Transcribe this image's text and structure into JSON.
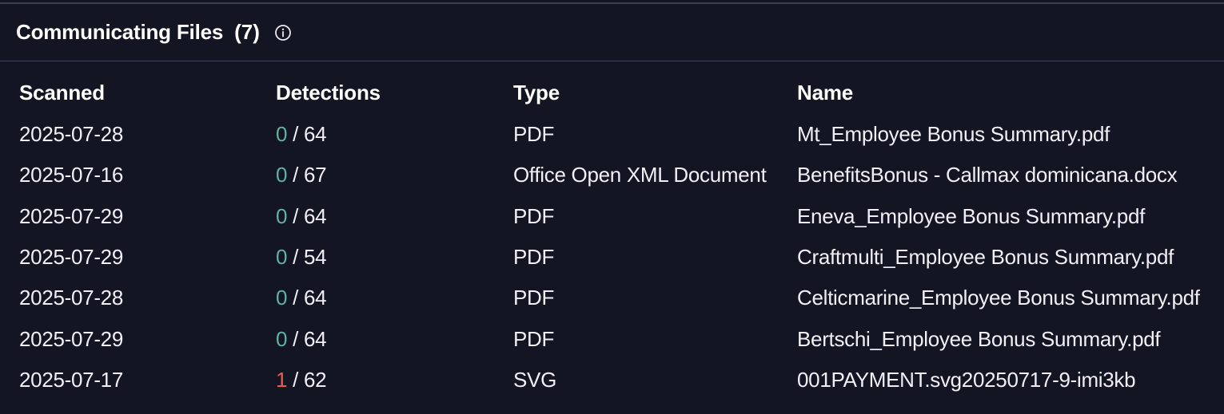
{
  "panel": {
    "title": "Communicating Files",
    "count": "(7)",
    "info_icon": "info-circle-icon"
  },
  "columns": {
    "scanned": "Scanned",
    "detections": "Detections",
    "type": "Type",
    "name": "Name"
  },
  "colors": {
    "background": "#131522",
    "clean_detection": "#5fb3a0",
    "malicious_detection": "#f0565a"
  },
  "rows": [
    {
      "scanned": "2025-07-28",
      "detected": "0",
      "separator": " / ",
      "total": "64",
      "type": "PDF",
      "name": "Mt_Employee Bonus Summary.pdf"
    },
    {
      "scanned": "2025-07-16",
      "detected": "0",
      "separator": " / ",
      "total": "67",
      "type": "Office Open XML Document",
      "name": "BenefitsBonus - Callmax dominicana.docx"
    },
    {
      "scanned": "2025-07-29",
      "detected": "0",
      "separator": " / ",
      "total": "64",
      "type": "PDF",
      "name": "Eneva_Employee Bonus Summary.pdf"
    },
    {
      "scanned": "2025-07-29",
      "detected": "0",
      "separator": " / ",
      "total": "54",
      "type": "PDF",
      "name": "Craftmulti_Employee Bonus Summary.pdf"
    },
    {
      "scanned": "2025-07-28",
      "detected": "0",
      "separator": " / ",
      "total": "64",
      "type": "PDF",
      "name": "Celticmarine_Employee Bonus Summary.pdf"
    },
    {
      "scanned": "2025-07-29",
      "detected": "0",
      "separator": " / ",
      "total": "64",
      "type": "PDF",
      "name": "Bertschi_Employee Bonus Summary.pdf"
    },
    {
      "scanned": "2025-07-17",
      "detected": "1",
      "separator": " / ",
      "total": "62",
      "type": "SVG",
      "name": "001PAYMENT.svg20250717-9-imi3kb"
    }
  ]
}
